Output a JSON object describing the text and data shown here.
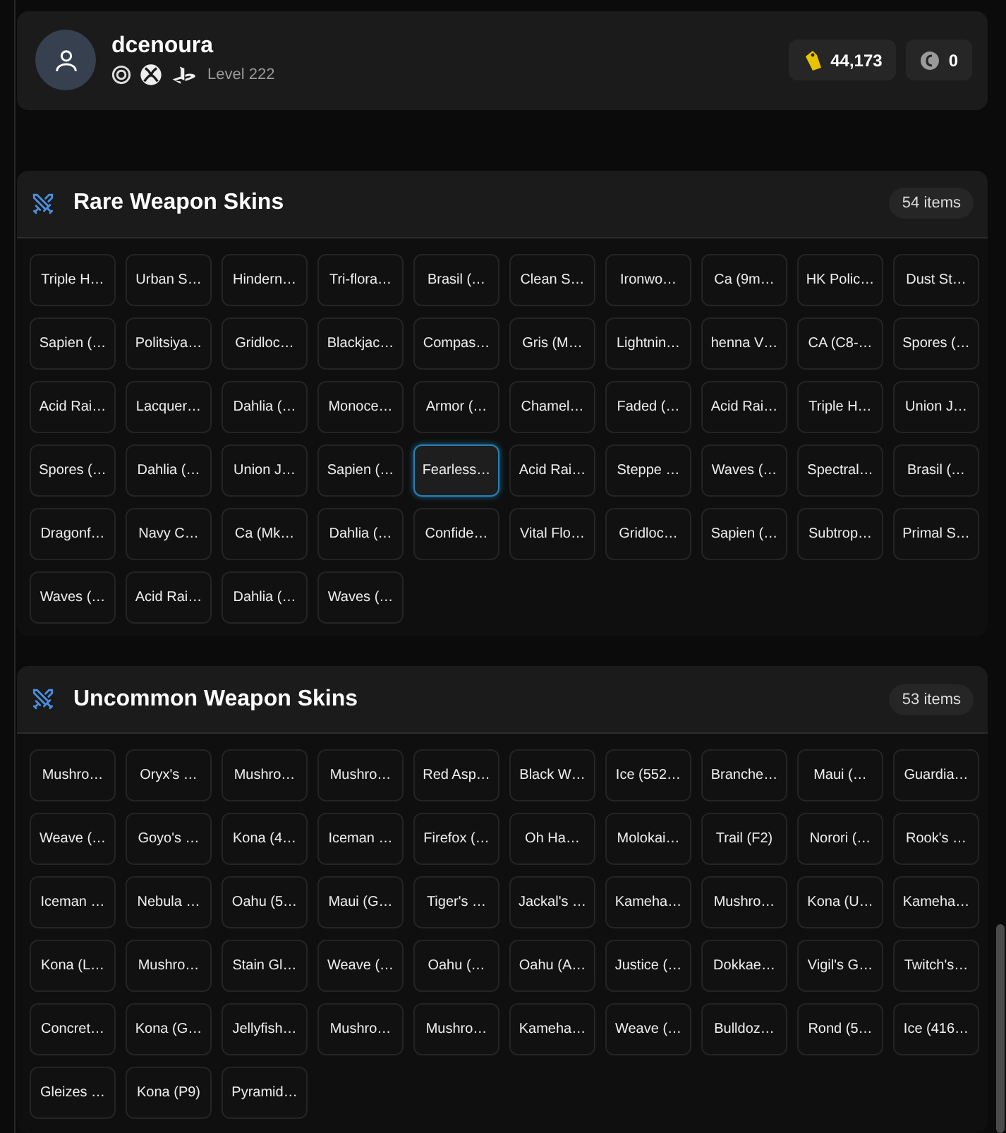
{
  "profile": {
    "username": "dcenoura",
    "level": "Level 222",
    "platforms": [
      {
        "kind": "ubisoft"
      },
      {
        "kind": "xbox"
      },
      {
        "kind": "playstation"
      }
    ]
  },
  "currencies": [
    {
      "kind": "renown",
      "amount": "44,173"
    },
    {
      "kind": "credits",
      "amount": "0"
    }
  ],
  "sections": [
    {
      "title": "Rare Weapon Skins",
      "count": "54 items",
      "items": [
        {
          "label": "Triple H…",
          "selected": false
        },
        {
          "label": "Urban S…",
          "selected": false
        },
        {
          "label": "Hindern…",
          "selected": false
        },
        {
          "label": "Tri-flora…",
          "selected": false
        },
        {
          "label": "Brasil (…",
          "selected": false
        },
        {
          "label": "Clean S…",
          "selected": false
        },
        {
          "label": "Ironwo…",
          "selected": false
        },
        {
          "label": "Ca (9m…",
          "selected": false
        },
        {
          "label": "HK Polic…",
          "selected": false
        },
        {
          "label": "Dust St…",
          "selected": false
        },
        {
          "label": "Sapien (…",
          "selected": false
        },
        {
          "label": "Politsiya…",
          "selected": false
        },
        {
          "label": "Gridloc…",
          "selected": false
        },
        {
          "label": "Blackjac…",
          "selected": false
        },
        {
          "label": "Compas…",
          "selected": false
        },
        {
          "label": "Gris (M…",
          "selected": false
        },
        {
          "label": "Lightnin…",
          "selected": false
        },
        {
          "label": "henna V…",
          "selected": false
        },
        {
          "label": "CA (C8-…",
          "selected": false
        },
        {
          "label": "Spores (…",
          "selected": false
        },
        {
          "label": "Acid Rai…",
          "selected": false
        },
        {
          "label": "Lacquer…",
          "selected": false
        },
        {
          "label": "Dahlia (…",
          "selected": false
        },
        {
          "label": "Monoce…",
          "selected": false
        },
        {
          "label": "Armor (…",
          "selected": false
        },
        {
          "label": "Chamel…",
          "selected": false
        },
        {
          "label": "Faded (…",
          "selected": false
        },
        {
          "label": "Acid Rai…",
          "selected": false
        },
        {
          "label": "Triple H…",
          "selected": false
        },
        {
          "label": "Union J…",
          "selected": false
        },
        {
          "label": "Spores (…",
          "selected": false
        },
        {
          "label": "Dahlia (…",
          "selected": false
        },
        {
          "label": "Union J…",
          "selected": false
        },
        {
          "label": "Sapien (…",
          "selected": false
        },
        {
          "label": "Fearless…",
          "selected": true
        },
        {
          "label": "Acid Rai…",
          "selected": false
        },
        {
          "label": "Steppe …",
          "selected": false
        },
        {
          "label": "Waves (…",
          "selected": false
        },
        {
          "label": "Spectral…",
          "selected": false
        },
        {
          "label": "Brasil (…",
          "selected": false
        },
        {
          "label": "Dragonf…",
          "selected": false
        },
        {
          "label": "Navy C…",
          "selected": false
        },
        {
          "label": "Ca (Mk…",
          "selected": false
        },
        {
          "label": "Dahlia (…",
          "selected": false
        },
        {
          "label": "Confide…",
          "selected": false
        },
        {
          "label": "Vital Flo…",
          "selected": false
        },
        {
          "label": "Gridloc…",
          "selected": false
        },
        {
          "label": "Sapien (…",
          "selected": false
        },
        {
          "label": "Subtrop…",
          "selected": false
        },
        {
          "label": "Primal S…",
          "selected": false
        },
        {
          "label": "Waves (…",
          "selected": false
        },
        {
          "label": "Acid Rai…",
          "selected": false
        },
        {
          "label": "Dahlia (…",
          "selected": false
        },
        {
          "label": "Waves (…",
          "selected": false
        }
      ]
    },
    {
      "title": "Uncommon Weapon Skins",
      "count": "53 items",
      "items": [
        {
          "label": "Mushro…",
          "selected": false
        },
        {
          "label": "Oryx's …",
          "selected": false
        },
        {
          "label": "Mushro…",
          "selected": false
        },
        {
          "label": "Mushro…",
          "selected": false
        },
        {
          "label": "Red Asp…",
          "selected": false
        },
        {
          "label": "Black W…",
          "selected": false
        },
        {
          "label": "Ice (552…",
          "selected": false
        },
        {
          "label": "Branche…",
          "selected": false
        },
        {
          "label": "Maui (…",
          "selected": false
        },
        {
          "label": "Guardia…",
          "selected": false
        },
        {
          "label": "Weave (…",
          "selected": false
        },
        {
          "label": "Goyo's …",
          "selected": false
        },
        {
          "label": "Kona (4…",
          "selected": false
        },
        {
          "label": "Iceman …",
          "selected": false
        },
        {
          "label": "Firefox (…",
          "selected": false
        },
        {
          "label": "Oh Ha…",
          "selected": false
        },
        {
          "label": "Molokai…",
          "selected": false
        },
        {
          "label": "Trail (F2)",
          "selected": false
        },
        {
          "label": "Norori (…",
          "selected": false
        },
        {
          "label": "Rook's …",
          "selected": false
        },
        {
          "label": "Iceman …",
          "selected": false
        },
        {
          "label": "Nebula …",
          "selected": false
        },
        {
          "label": "Oahu (5…",
          "selected": false
        },
        {
          "label": "Maui (G…",
          "selected": false
        },
        {
          "label": "Tiger's …",
          "selected": false
        },
        {
          "label": "Jackal's …",
          "selected": false
        },
        {
          "label": "Kameha…",
          "selected": false
        },
        {
          "label": "Mushro…",
          "selected": false
        },
        {
          "label": "Kona (U…",
          "selected": false
        },
        {
          "label": "Kameha…",
          "selected": false
        },
        {
          "label": "Kona (L…",
          "selected": false
        },
        {
          "label": "Mushro…",
          "selected": false
        },
        {
          "label": "Stain Gl…",
          "selected": false
        },
        {
          "label": "Weave (…",
          "selected": false
        },
        {
          "label": "Oahu (…",
          "selected": false
        },
        {
          "label": "Oahu (A…",
          "selected": false
        },
        {
          "label": "Justice (…",
          "selected": false
        },
        {
          "label": "Dokkae…",
          "selected": false
        },
        {
          "label": "Vigil's G…",
          "selected": false
        },
        {
          "label": "Twitch's…",
          "selected": false
        },
        {
          "label": "Concret…",
          "selected": false
        },
        {
          "label": "Kona (G…",
          "selected": false
        },
        {
          "label": "Jellyfish…",
          "selected": false
        },
        {
          "label": "Mushro…",
          "selected": false
        },
        {
          "label": "Mushro…",
          "selected": false
        },
        {
          "label": "Kameha…",
          "selected": false
        },
        {
          "label": "Weave (…",
          "selected": false
        },
        {
          "label": "Bulldoz…",
          "selected": false
        },
        {
          "label": "Rond (5…",
          "selected": false
        },
        {
          "label": "Ice (416…",
          "selected": false
        },
        {
          "label": "Gleizes …",
          "selected": false
        },
        {
          "label": "Kona (P9)",
          "selected": false
        },
        {
          "label": "Pyramid…",
          "selected": false
        }
      ]
    }
  ]
}
